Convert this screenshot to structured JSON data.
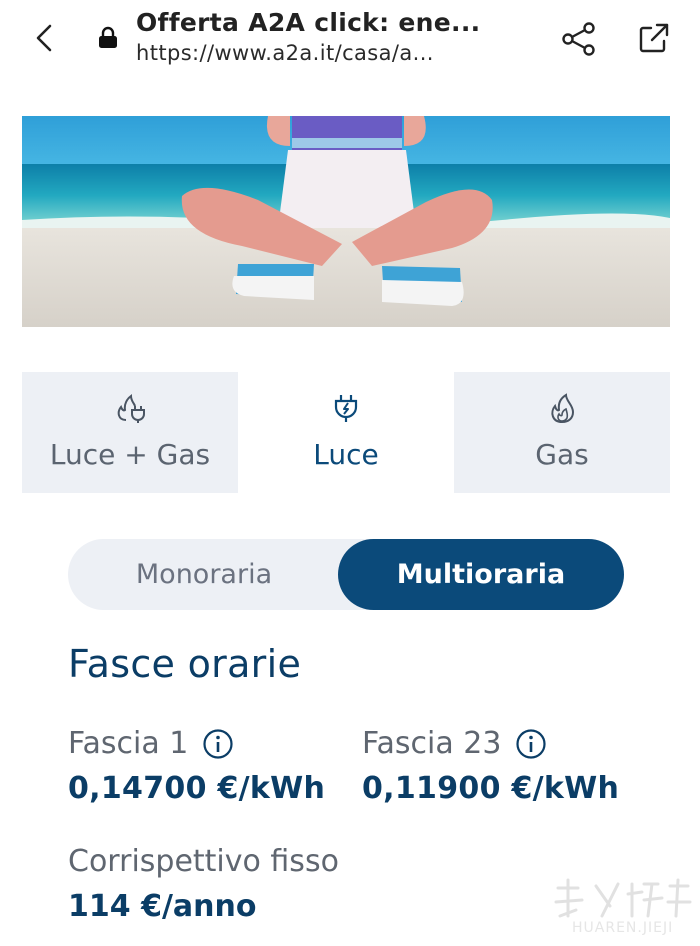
{
  "browser": {
    "title": "Offerta A2A click: ene...",
    "url": "https://www.a2a.it/casa/a..."
  },
  "tabs": [
    {
      "label": "Luce + Gas",
      "icon": "flame-plug-icon",
      "active": false
    },
    {
      "label": "Luce",
      "icon": "plug-bolt-icon",
      "active": true
    },
    {
      "label": "Gas",
      "icon": "flame-icon",
      "active": false
    }
  ],
  "rate_toggle": {
    "options": [
      "Monoraria",
      "Multioraria"
    ],
    "selected": "Multioraria"
  },
  "section": {
    "title": "Fasce orarie"
  },
  "bands": [
    {
      "label": "Fascia 1",
      "value": "0,14700 €/kWh"
    },
    {
      "label": "Fascia 23",
      "value": "0,11900 €/kWh"
    }
  ],
  "fixed_fee": {
    "label": "Corrispettivo fisso",
    "value": "114 €/anno"
  },
  "watermark": {
    "text": "HUAREN.JIEJI"
  },
  "colors": {
    "brand_blue": "#0b4a7a",
    "tab_inactive_bg": "#edf0f5",
    "text_grey": "#5f6670"
  }
}
